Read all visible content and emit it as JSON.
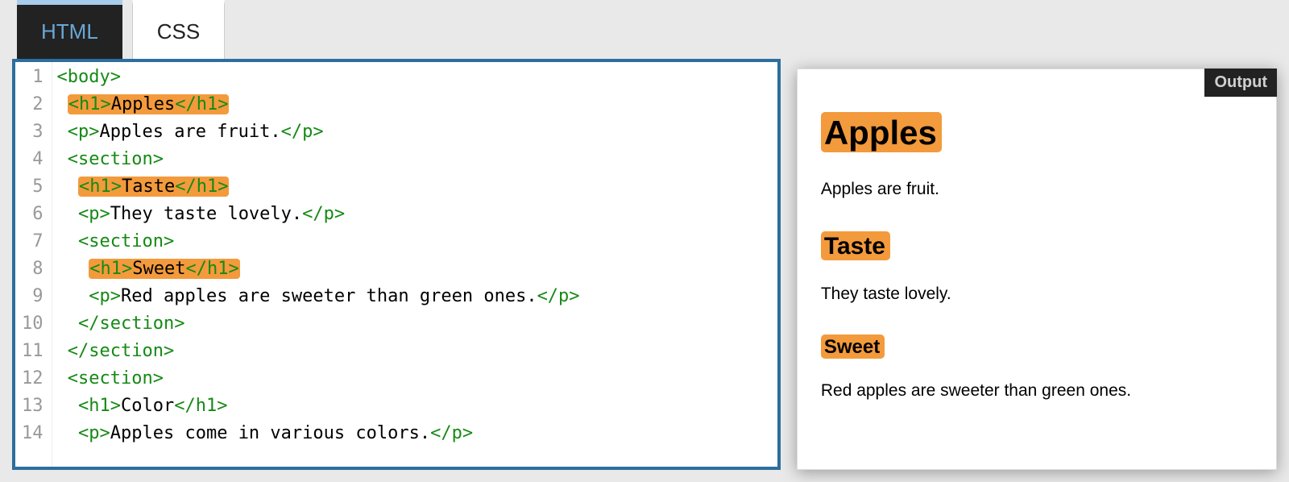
{
  "tabs": {
    "html": "HTML",
    "css": "CSS"
  },
  "code": {
    "lines": [
      [
        {
          "t": "tag",
          "v": "<body>"
        }
      ],
      [
        {
          "t": "sp",
          "v": " "
        },
        {
          "t": "hl-open",
          "v": "<h1>"
        },
        {
          "t": "hl-txt",
          "v": "Apples"
        },
        {
          "t": "hl-close",
          "v": "</h1>"
        }
      ],
      [
        {
          "t": "sp",
          "v": " "
        },
        {
          "t": "tag",
          "v": "<p>"
        },
        {
          "t": "txt",
          "v": "Apples are fruit."
        },
        {
          "t": "tag",
          "v": "</p>"
        }
      ],
      [
        {
          "t": "sp",
          "v": " "
        },
        {
          "t": "tag",
          "v": "<section>"
        }
      ],
      [
        {
          "t": "sp",
          "v": "  "
        },
        {
          "t": "hl-open",
          "v": "<h1>"
        },
        {
          "t": "hl-txt",
          "v": "Taste"
        },
        {
          "t": "hl-close",
          "v": "</h1>"
        }
      ],
      [
        {
          "t": "sp",
          "v": "  "
        },
        {
          "t": "tag",
          "v": "<p>"
        },
        {
          "t": "txt",
          "v": "They taste lovely."
        },
        {
          "t": "tag",
          "v": "</p>"
        }
      ],
      [
        {
          "t": "sp",
          "v": "  "
        },
        {
          "t": "tag",
          "v": "<section>"
        }
      ],
      [
        {
          "t": "sp",
          "v": "   "
        },
        {
          "t": "hl-open",
          "v": "<h1>"
        },
        {
          "t": "hl-txt",
          "v": "Sweet"
        },
        {
          "t": "hl-close",
          "v": "</h1>"
        }
      ],
      [
        {
          "t": "sp",
          "v": "   "
        },
        {
          "t": "tag",
          "v": "<p>"
        },
        {
          "t": "txt",
          "v": "Red apples are sweeter than green ones."
        },
        {
          "t": "tag",
          "v": "</p>"
        }
      ],
      [
        {
          "t": "sp",
          "v": "  "
        },
        {
          "t": "tag",
          "v": "</section>"
        }
      ],
      [
        {
          "t": "sp",
          "v": " "
        },
        {
          "t": "tag",
          "v": "</section>"
        }
      ],
      [
        {
          "t": "sp",
          "v": " "
        },
        {
          "t": "tag",
          "v": "<section>"
        }
      ],
      [
        {
          "t": "sp",
          "v": "  "
        },
        {
          "t": "tag",
          "v": "<h1>"
        },
        {
          "t": "txt",
          "v": "Color"
        },
        {
          "t": "tag",
          "v": "</h1>"
        }
      ],
      [
        {
          "t": "sp",
          "v": "  "
        },
        {
          "t": "tag",
          "v": "<p>"
        },
        {
          "t": "txt",
          "v": "Apples come in various colors."
        },
        {
          "t": "tag",
          "v": "</p>"
        }
      ]
    ]
  },
  "output": {
    "label": "Output",
    "h1": "Apples",
    "p1": "Apples are fruit.",
    "h2": "Taste",
    "p2": "They taste lovely.",
    "h3": "Sweet",
    "p3": "Red apples are sweeter than green ones."
  }
}
